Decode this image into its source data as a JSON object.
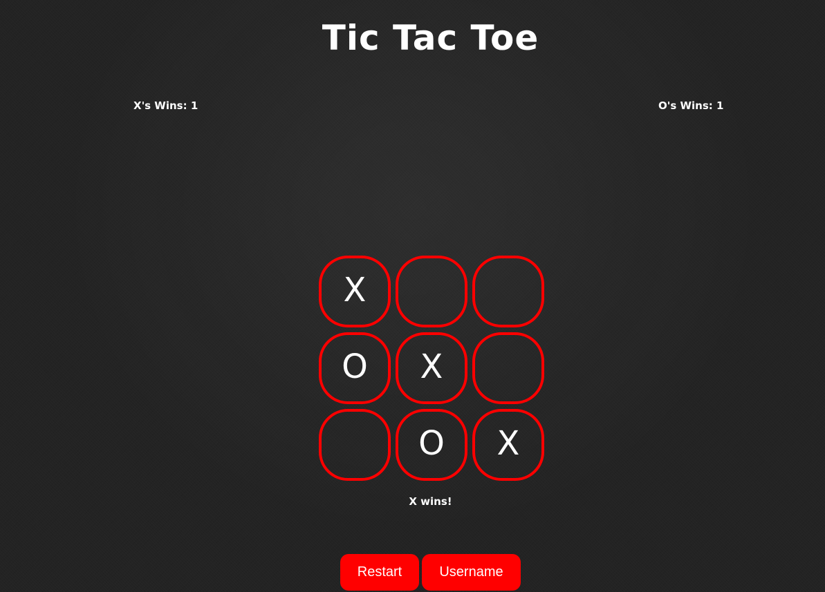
{
  "title": "Tic Tac Toe",
  "scores": {
    "x_label": "X's Wins: 1",
    "o_label": "O's Wins: 1"
  },
  "board": {
    "cells": [
      "X",
      "",
      "",
      "O",
      "X",
      "",
      "",
      "O",
      "X"
    ]
  },
  "status": "X wins!",
  "buttons": {
    "restart": "Restart",
    "username": "Username"
  },
  "colors": {
    "background": "#232323",
    "accent": "#ff0000",
    "text": "#ffffff"
  }
}
